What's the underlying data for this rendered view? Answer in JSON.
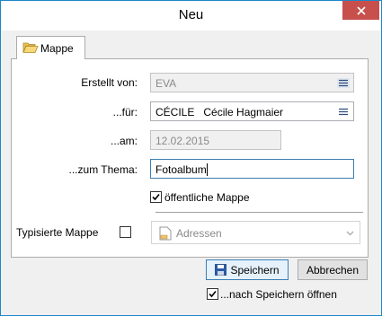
{
  "window": {
    "title": "Neu"
  },
  "tab": {
    "label": "Mappe"
  },
  "form": {
    "created_by": {
      "label": "Erstellt von:",
      "value": "EVA"
    },
    "for": {
      "label": "...für:",
      "value": "CÉCILE   Cécile Hagmaier"
    },
    "on": {
      "label": "...am:",
      "value": "12.02.2015"
    },
    "topic": {
      "label": "...zum Thema:",
      "value": "Fotoalbum"
    },
    "public": {
      "label": "öffentliche Mappe",
      "checked": true
    },
    "typed": {
      "label": "Typisierte Mappe",
      "checked": false
    },
    "type_select": {
      "value": "Adressen"
    }
  },
  "buttons": {
    "save": "Speichern",
    "cancel": "Abbrechen"
  },
  "open_after_save": {
    "label": "...nach Speichern öffnen",
    "checked": true
  },
  "colors": {
    "accent": "#1d87c9",
    "close": "#c7504d",
    "focus": "#3c7fb1"
  }
}
